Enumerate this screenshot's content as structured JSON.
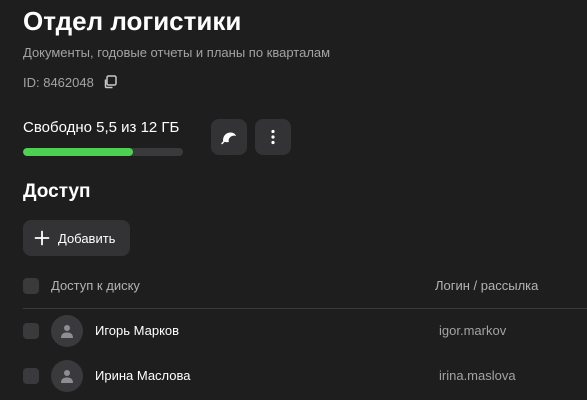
{
  "header": {
    "title": "Отдел логистики",
    "subtitle": "Документы, годовые отчеты и планы по кварталам",
    "id_label": "ID: 8462048",
    "copy_icon": "copy-icon"
  },
  "storage": {
    "label": "Свободно 5,5 из 12 ГБ",
    "used_fraction": 0.69,
    "bar_color": "#4cd151",
    "theme_icon": "half-moon-icon",
    "more_icon": "more-vertical-icon"
  },
  "access": {
    "section_title": "Доступ",
    "add_button_label": "Добавить",
    "add_icon": "plus-icon",
    "columns": {
      "access": "Доступ к диску",
      "login": "Логин / рассылка"
    },
    "users": [
      {
        "name": "Игорь Марков",
        "login": "igor.markov"
      },
      {
        "name": "Ирина Маслова",
        "login": "irina.maslova"
      }
    ]
  },
  "colors": {
    "background": "#1e1e1f",
    "accent": "#4cd151",
    "muted_text": "#a3a3a6"
  }
}
